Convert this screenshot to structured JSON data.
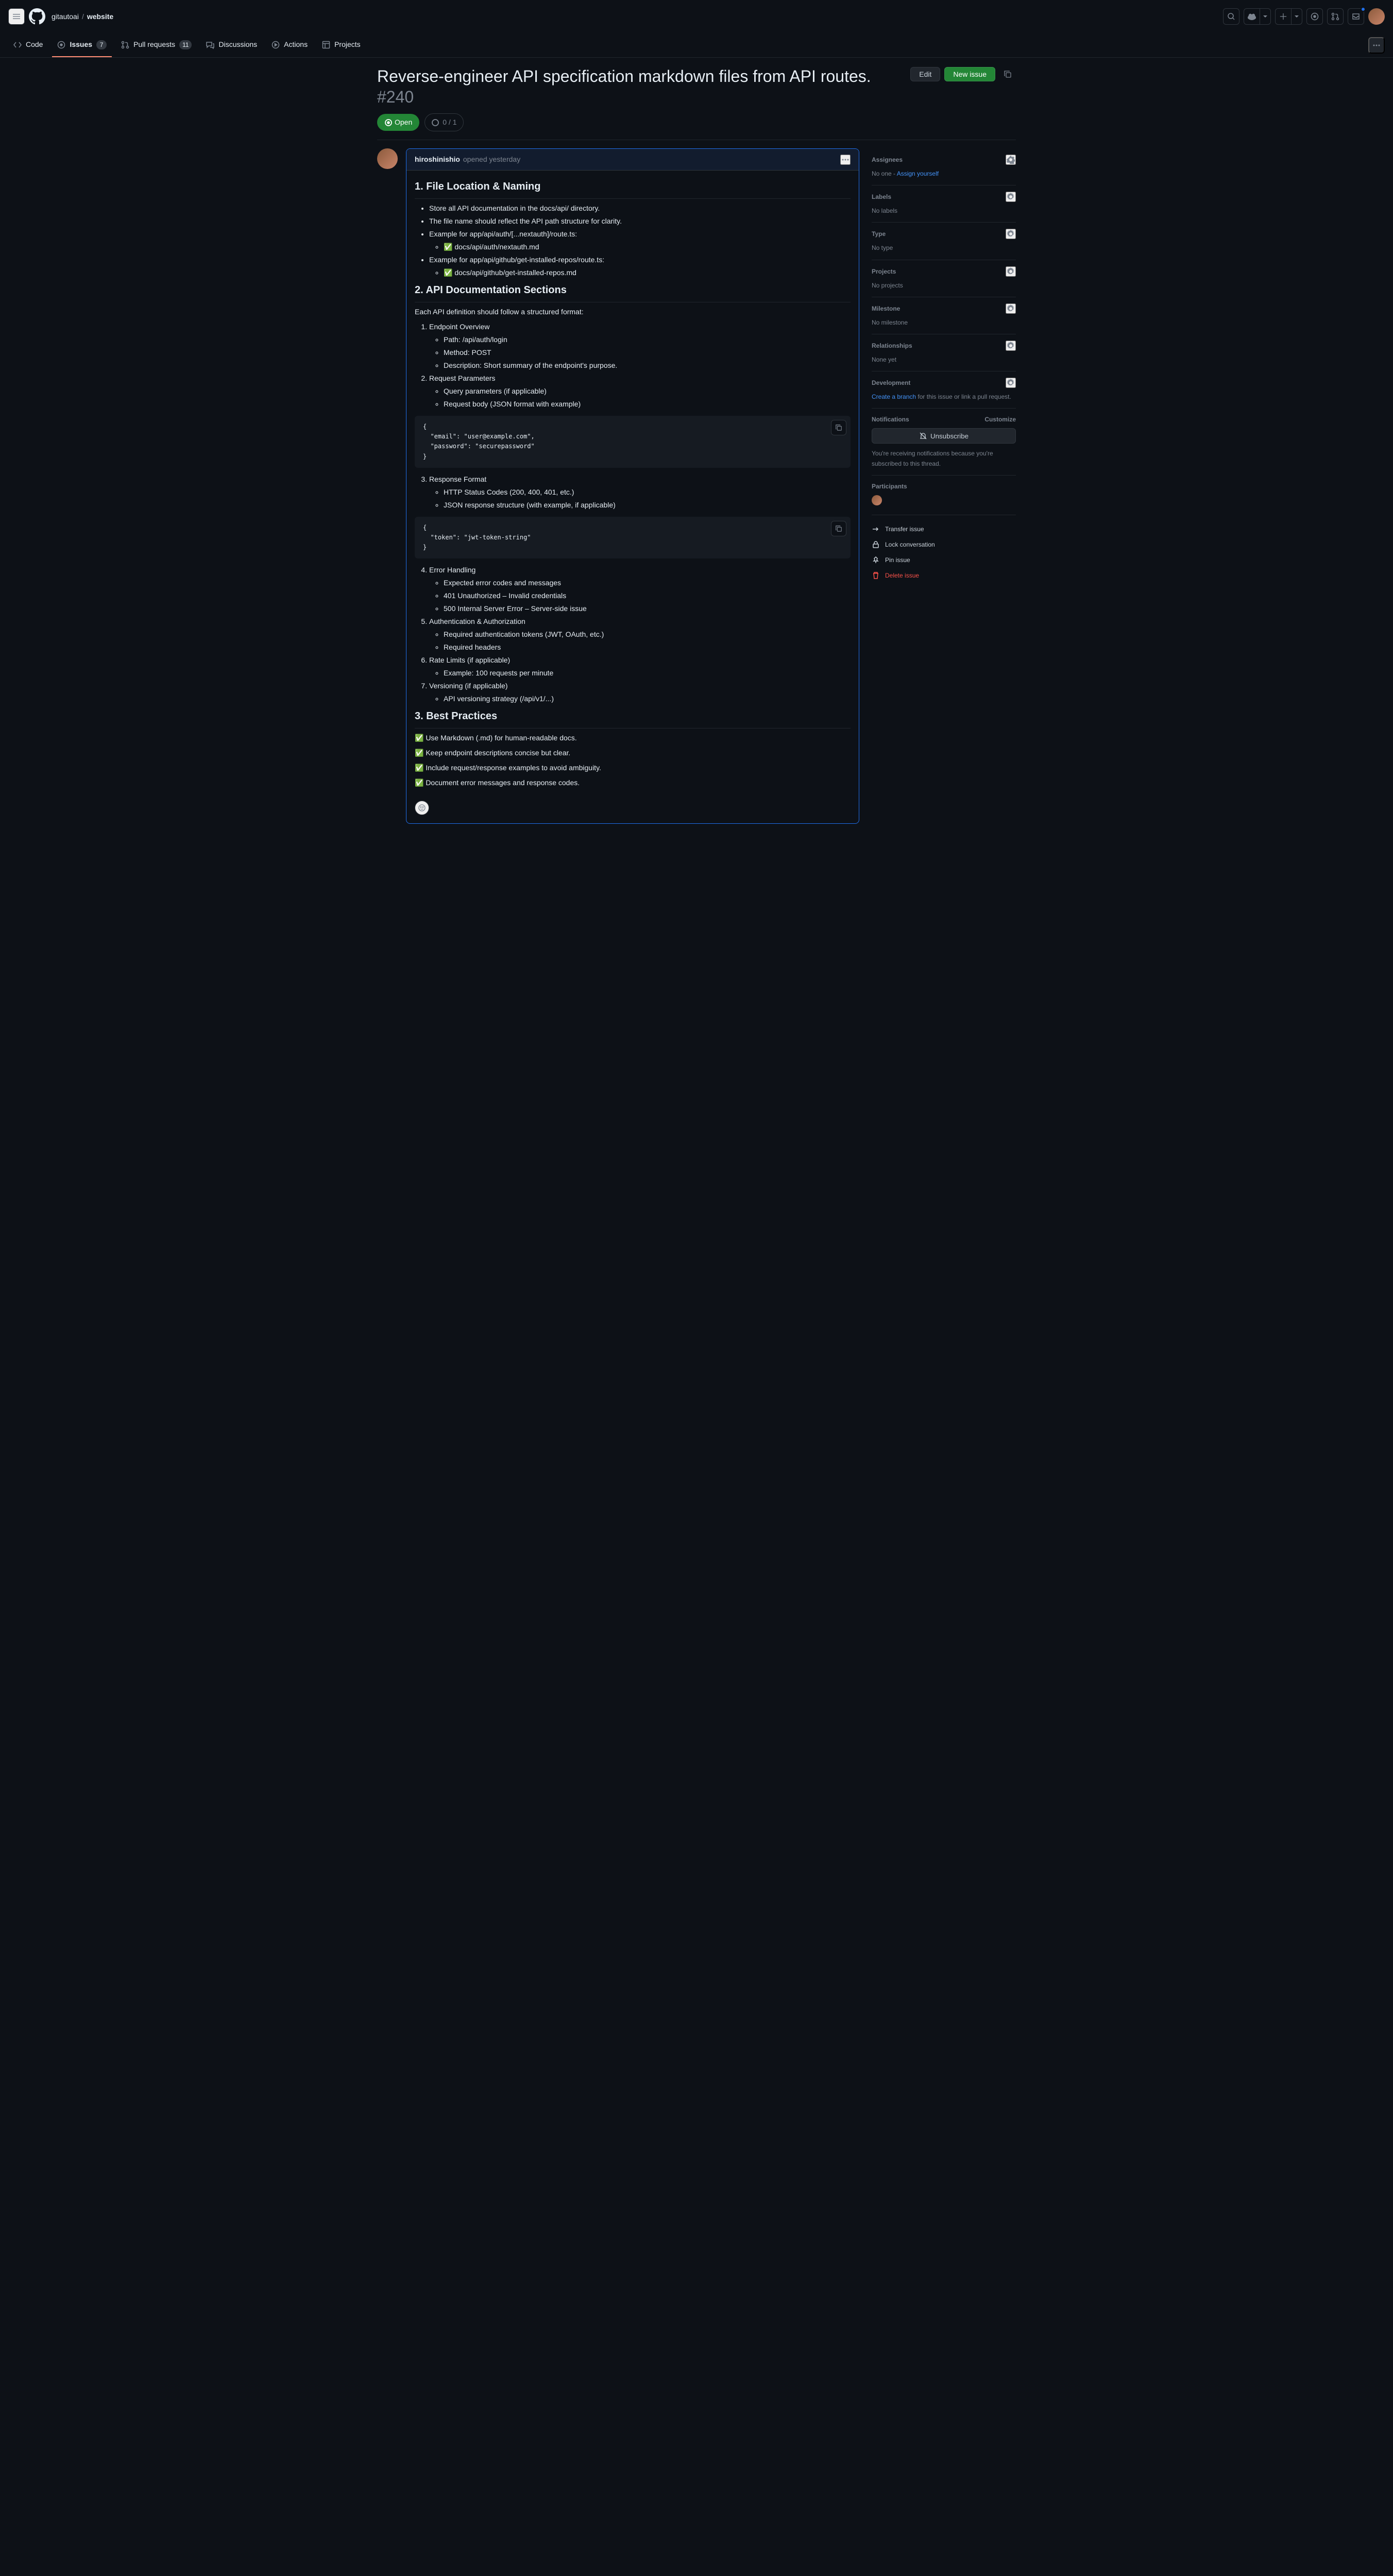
{
  "breadcrumb": {
    "org": "gitautoai",
    "repo": "website"
  },
  "nav": {
    "code": "Code",
    "issues": "Issues",
    "issues_count": "7",
    "pulls": "Pull requests",
    "pulls_count": "11",
    "discussions": "Discussions",
    "actions": "Actions",
    "projects": "Projects"
  },
  "issue": {
    "title": "Reverse-engineer API specification markdown files from API routes.",
    "number": "#240",
    "edit": "Edit",
    "new": "New issue",
    "state": "Open",
    "tasks": "0 / 1"
  },
  "comment": {
    "author": "hiroshinishio",
    "meta": "opened yesterday",
    "h1": "1. File Location & Naming",
    "b1": "Store all API documentation in the docs/api/ directory.",
    "b2": "The file name should reflect the API path structure for clarity.",
    "b3": "Example for app/api/auth/[...nextauth]/route.ts:",
    "b3a": "✅ docs/api/auth/nextauth.md",
    "b4": "Example for app/api/github/get-installed-repos/route.ts:",
    "b4a": "✅ docs/api/github/get-installed-repos.md",
    "h2": "2. API Documentation Sections",
    "p2": "Each API definition should follow a structured format:",
    "o1": "Endpoint Overview",
    "o1a": "Path: /api/auth/login",
    "o1b": "Method: POST",
    "o1c": "Description: Short summary of the endpoint's purpose.",
    "o2": "Request Parameters",
    "o2a": "Query parameters (if applicable)",
    "o2b": "Request body (JSON format with example)",
    "code1": "{\n  \"email\": \"user@example.com\",\n  \"password\": \"securepassword\"\n}",
    "o3": "Response Format",
    "o3a": "HTTP Status Codes (200, 400, 401, etc.)",
    "o3b": "JSON response structure (with example, if applicable)",
    "code2": "{\n  \"token\": \"jwt-token-string\"\n}",
    "o4": "Error Handling",
    "o4a": "Expected error codes and messages",
    "o4b": "401 Unauthorized – Invalid credentials",
    "o4c": "500 Internal Server Error – Server-side issue",
    "o5": "Authentication & Authorization",
    "o5a": "Required authentication tokens (JWT, OAuth, etc.)",
    "o5b": "Required headers",
    "o6": "Rate Limits (if applicable)",
    "o6a": "Example: 100 requests per minute",
    "o7": "Versioning (if applicable)",
    "o7a": "API versioning strategy (/api/v1/...)",
    "h3": "3. Best Practices",
    "bp1": "✅ Use Markdown (.md) for human-readable docs.",
    "bp2": "✅ Keep endpoint descriptions concise but clear.",
    "bp3": "✅ Include request/response examples to avoid ambiguity.",
    "bp4": "✅ Document error messages and response codes."
  },
  "side": {
    "assignees": "Assignees",
    "assignees_body_prefix": "No one - ",
    "assign_yourself": "Assign yourself",
    "labels": "Labels",
    "labels_body": "No labels",
    "type": "Type",
    "type_body": "No type",
    "projects": "Projects",
    "projects_body": "No projects",
    "milestone": "Milestone",
    "milestone_body": "No milestone",
    "relationships": "Relationships",
    "relationships_body": "None yet",
    "development": "Development",
    "create_branch": "Create a branch",
    "dev_suffix": " for this issue or link a pull request.",
    "notifications": "Notifications",
    "customize": "Customize",
    "unsubscribe": "Unsubscribe",
    "notif_desc": "You're receiving notifications because you're subscribed to this thread.",
    "participants": "Participants",
    "transfer": "Transfer issue",
    "lock": "Lock conversation",
    "pin": "Pin issue",
    "delete": "Delete issue"
  }
}
